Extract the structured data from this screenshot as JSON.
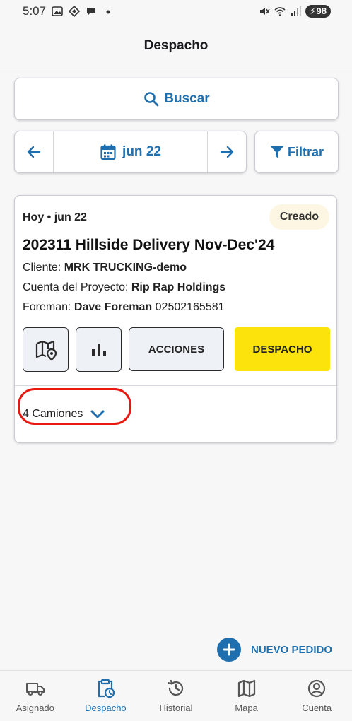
{
  "status_bar": {
    "time": "5:07",
    "battery": "98"
  },
  "app_bar": {
    "title": "Despacho"
  },
  "search": {
    "label": "Buscar"
  },
  "date_nav": {
    "date": "jun 22"
  },
  "filter": {
    "label": "Filtrar"
  },
  "order": {
    "date_line": "Hoy • jun 22",
    "status": "Creado",
    "title": "202311 Hillside Delivery Nov-Dec'24",
    "client_label": "Cliente:",
    "client_value": "MRK TRUCKING-demo",
    "account_label": "Cuenta del Proyecto:",
    "account_value": "Rip Rap Holdings",
    "foreman_label": "Foreman:",
    "foreman_name": "Dave Foreman",
    "foreman_phone": "02502165581",
    "acciones_label": "ACCIONES",
    "despacho_label": "DESPACHO",
    "trucks_label": "4 Camiones"
  },
  "fab": {
    "label": "NUEVO PEDIDO"
  },
  "bottom_nav": {
    "items": [
      {
        "label": "Asignado",
        "icon": "truck-icon"
      },
      {
        "label": "Despacho",
        "icon": "clipboard-clock-icon"
      },
      {
        "label": "Historial",
        "icon": "history-icon"
      },
      {
        "label": "Mapa",
        "icon": "map-icon"
      },
      {
        "label": "Cuenta",
        "icon": "account-icon"
      }
    ],
    "active_index": 1
  },
  "colors": {
    "accent": "#1f6fae",
    "dispatch_button": "#fbe30b",
    "status_chip_bg": "#fdf6e3",
    "highlight_ring": "#e8170f"
  }
}
